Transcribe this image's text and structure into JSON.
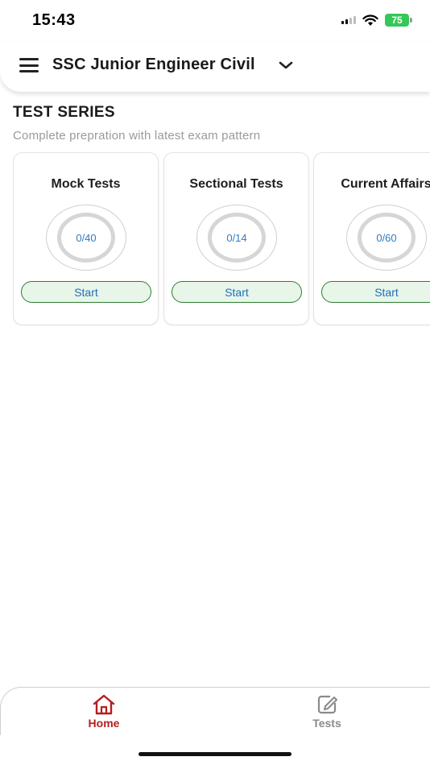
{
  "status_bar": {
    "time": "15:43",
    "battery": "75",
    "icons": [
      "signal-icon",
      "wifi-icon",
      "battery-icon"
    ]
  },
  "header": {
    "menu_icon": "menu-icon",
    "title": "SSC Junior Engineer Civil",
    "dropdown_icon": "chevron-down-icon"
  },
  "section": {
    "title": "TEST SERIES",
    "subtitle": "Complete prepration with latest exam pattern"
  },
  "cards": [
    {
      "title": "Mock Tests",
      "progress": "0/40",
      "button": "Start"
    },
    {
      "title": "Sectional Tests",
      "progress": "0/14",
      "button": "Start"
    },
    {
      "title": "Current Affairs",
      "progress": "0/60",
      "button": "Start"
    }
  ],
  "bottom_nav": {
    "items": [
      {
        "label": "Home",
        "icon": "home-icon",
        "active": true
      },
      {
        "label": "Tests",
        "icon": "edit-note-icon",
        "active": false
      }
    ]
  },
  "colors": {
    "active_nav": "#b71c1c",
    "inactive_nav": "#8a8a8a",
    "start_border": "#2e7d32",
    "start_bg": "#e8f5e9",
    "progress_text": "#2d7dc2",
    "battery": "#34c759"
  }
}
